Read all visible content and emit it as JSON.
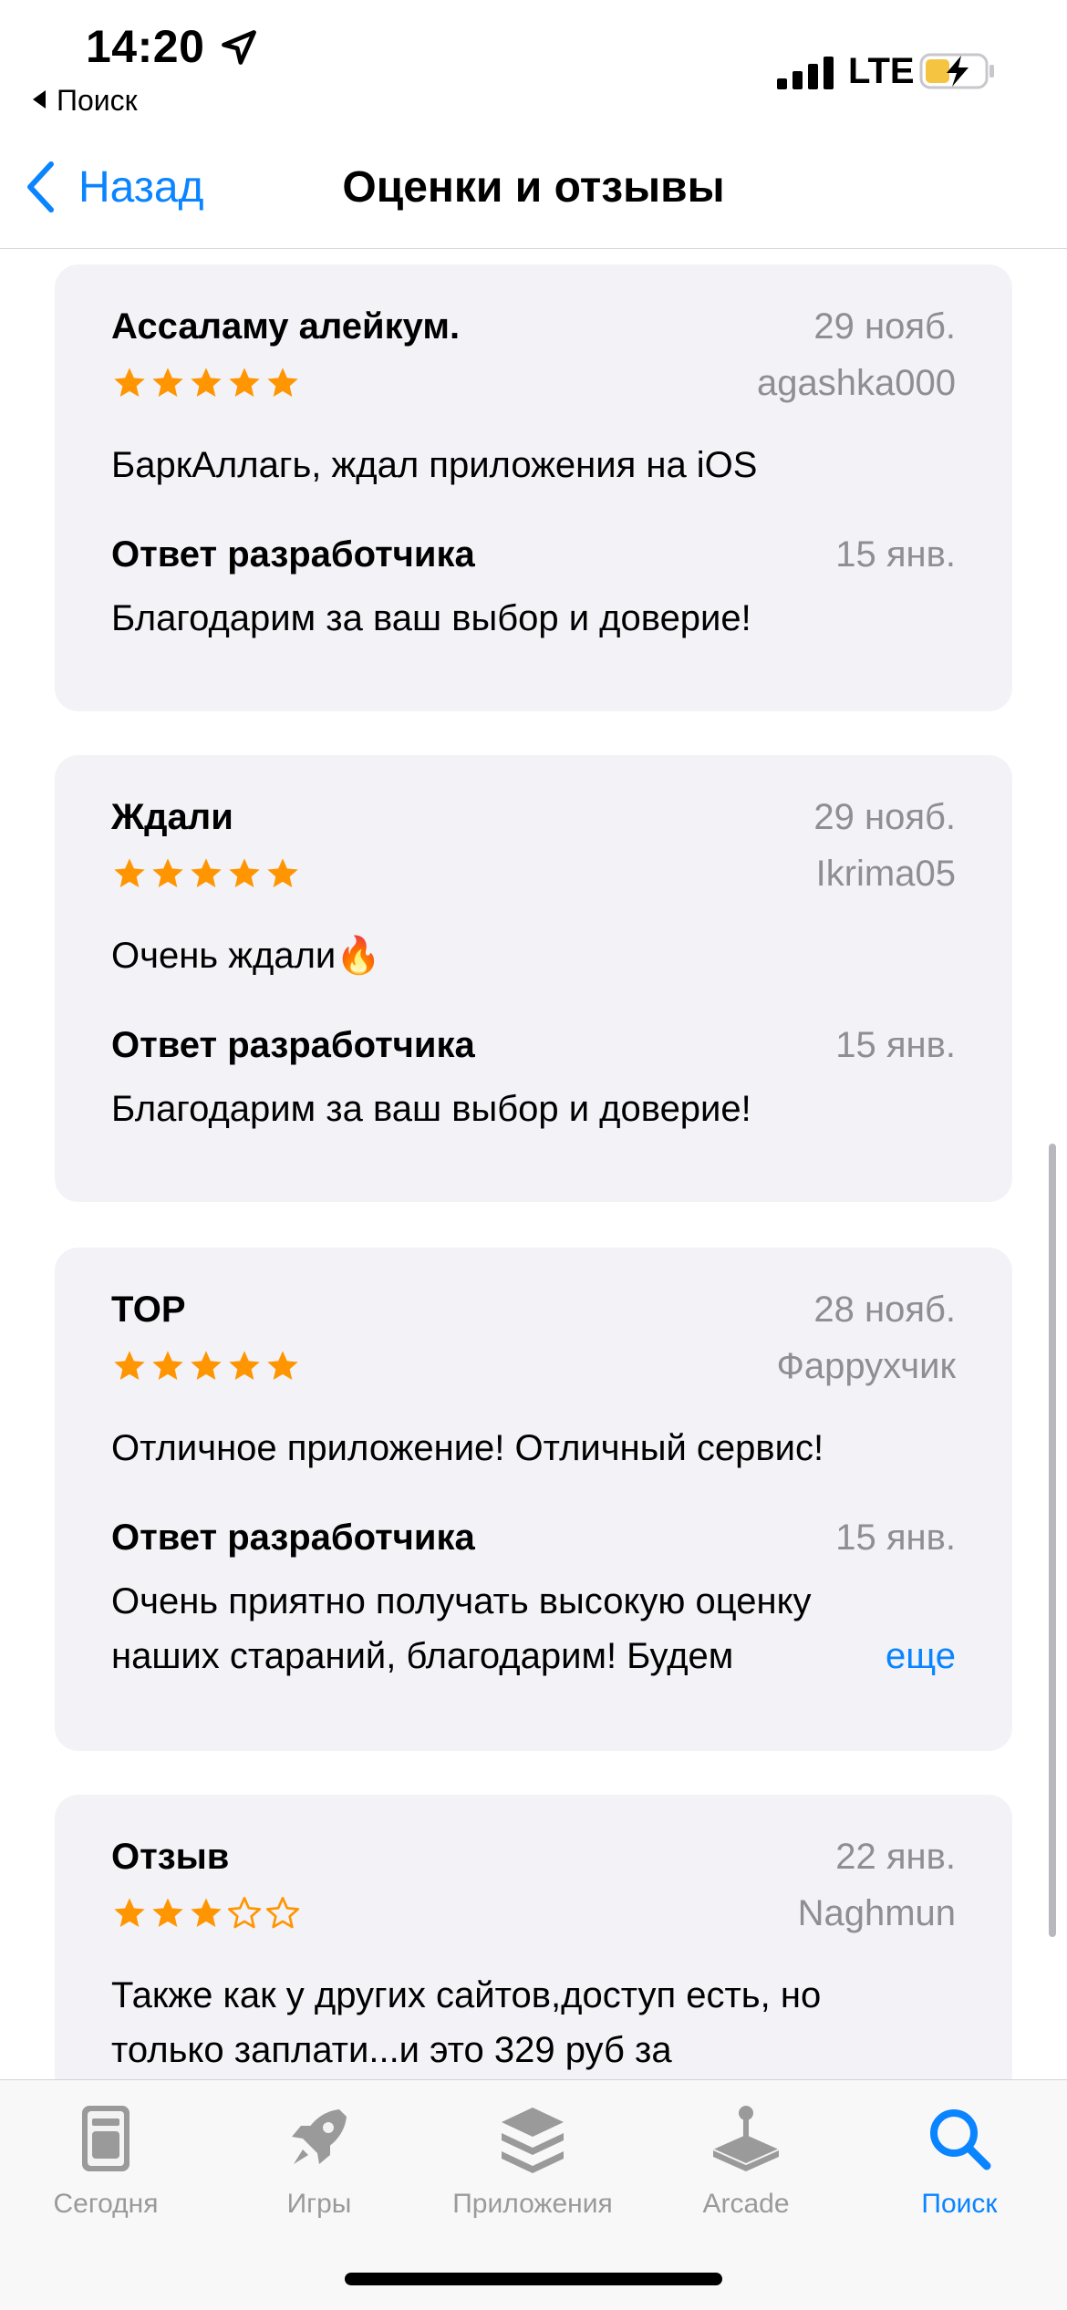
{
  "status_bar": {
    "time": "14:20",
    "back_app": "Поиск",
    "network": "LTE",
    "battery_color": "#F5C542"
  },
  "nav": {
    "back_label": "Назад",
    "title": "Оценки и отзывы"
  },
  "reviews": [
    {
      "title": "Ассаламу алейкум.",
      "date": "29 нояб.",
      "author": "agashka000",
      "rating": 5,
      "text": "БаркАллагь, ждал приложения на iOS",
      "reply_label": "Ответ разработчика",
      "reply_date": "15 янв.",
      "reply_text": "Благодарим за ваш выбор и доверие!"
    },
    {
      "title": "Ждали",
      "date": "29 нояб.",
      "author": "Ikrima05",
      "rating": 5,
      "text": "Очень ждали🔥",
      "reply_label": "Ответ разработчика",
      "reply_date": "15 янв.",
      "reply_text": "Благодарим за ваш выбор и доверие!"
    },
    {
      "title": "TOP",
      "date": "28 нояб.",
      "author": "Фаррухчик",
      "rating": 5,
      "text": "Отличное приложение! Отличный сервис!",
      "reply_label": "Ответ разработчика",
      "reply_date": "15 янв.",
      "reply_text_1": "Очень приятно получать высокую оценку",
      "reply_text_2": "наших стараний, благодарим! Будем",
      "more_label": "еще"
    },
    {
      "title": "Отзыв",
      "date": "22 янв.",
      "author": "Naghmun",
      "rating": 3,
      "text_1": "Также как у других сайтов,доступ есть, но",
      "text_2": "только заплати...и это 329 руб за"
    }
  ],
  "tabs": [
    {
      "label": "Сегодня",
      "icon": "today-icon"
    },
    {
      "label": "Игры",
      "icon": "rocket-icon"
    },
    {
      "label": "Приложения",
      "icon": "apps-stack-icon"
    },
    {
      "label": "Arcade",
      "icon": "joystick-icon"
    },
    {
      "label": "Поиск",
      "icon": "search-icon",
      "active": true
    }
  ],
  "colors": {
    "accent": "#0A84FF",
    "star": "#FF9500",
    "secondary_text": "#8E8E93",
    "card_bg": "#F2F2F7"
  }
}
